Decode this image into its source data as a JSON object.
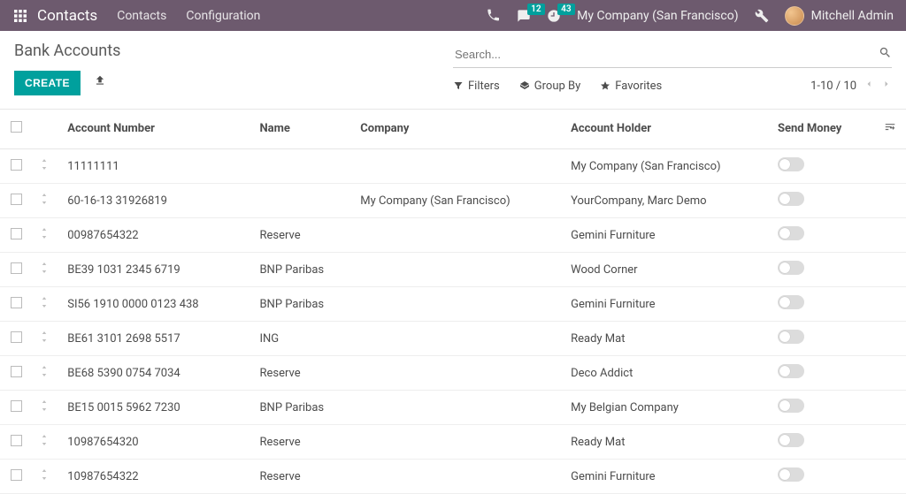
{
  "topbar": {
    "brand": "Contacts",
    "nav": [
      "Contacts",
      "Configuration"
    ],
    "messages_badge": "12",
    "activities_badge": "43",
    "company": "My Company (San Francisco)",
    "user": "Mitchell Admin"
  },
  "breadcrumb": "Bank Accounts",
  "buttons": {
    "create": "CREATE"
  },
  "search": {
    "placeholder": "Search..."
  },
  "filters": {
    "filters": "Filters",
    "groupby": "Group By",
    "favorites": "Favorites"
  },
  "pager": {
    "range": "1-10 / 10"
  },
  "columns": {
    "account_number": "Account Number",
    "name": "Name",
    "company": "Company",
    "account_holder": "Account Holder",
    "send_money": "Send Money"
  },
  "rows": [
    {
      "account_number": "11111111",
      "name": "",
      "company": "",
      "account_holder": "My Company (San Francisco)"
    },
    {
      "account_number": "60-16-13 31926819",
      "name": "",
      "company": "My Company (San Francisco)",
      "account_holder": "YourCompany, Marc Demo"
    },
    {
      "account_number": "00987654322",
      "name": "Reserve",
      "company": "",
      "account_holder": "Gemini Furniture"
    },
    {
      "account_number": "BE39 1031 2345 6719",
      "name": "BNP Paribas",
      "company": "",
      "account_holder": "Wood Corner"
    },
    {
      "account_number": "SI56 1910 0000 0123 438",
      "name": "BNP Paribas",
      "company": "",
      "account_holder": "Gemini Furniture"
    },
    {
      "account_number": "BE61 3101 2698 5517",
      "name": "ING",
      "company": "",
      "account_holder": "Ready Mat"
    },
    {
      "account_number": "BE68 5390 0754 7034",
      "name": "Reserve",
      "company": "",
      "account_holder": "Deco Addict"
    },
    {
      "account_number": "BE15 0015 5962 7230",
      "name": "BNP Paribas",
      "company": "",
      "account_holder": "My Belgian Company"
    },
    {
      "account_number": "10987654320",
      "name": "Reserve",
      "company": "",
      "account_holder": "Ready Mat"
    },
    {
      "account_number": "10987654322",
      "name": "Reserve",
      "company": "",
      "account_holder": "Gemini Furniture"
    }
  ]
}
